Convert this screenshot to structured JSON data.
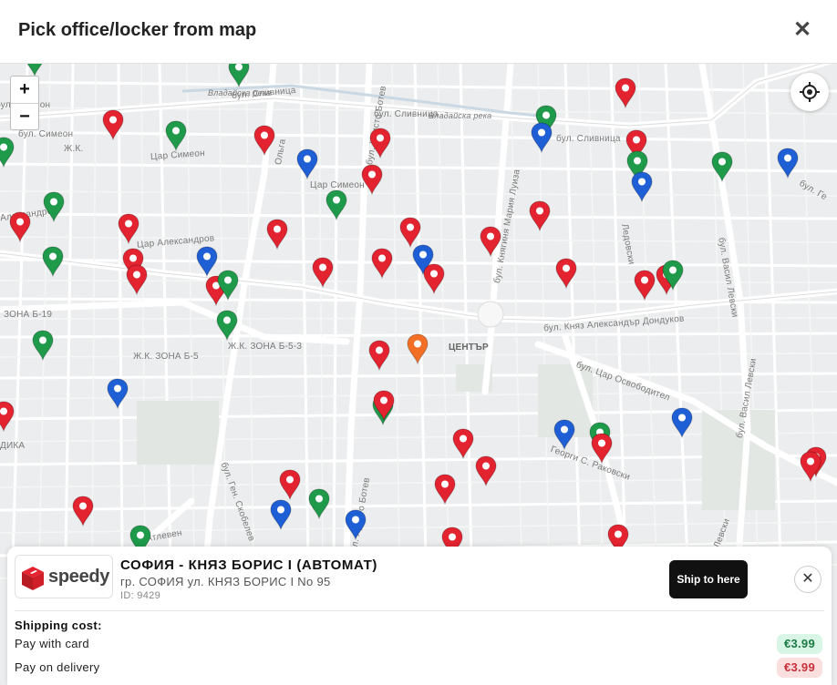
{
  "header": {
    "title": "Pick office/locker from map",
    "close_icon": "close-icon"
  },
  "map": {
    "zoom_in_label": "+",
    "zoom_out_label": "−",
    "locate_icon": "crosshair-icon",
    "streets": [
      "бул. Сливница",
      "бул. Сливница",
      "бул. Сливница",
      "Владайска река",
      "Владайска река",
      "бул. Симеон",
      "бул. Симеон",
      "Цар Симеон",
      "Цар Симеон",
      "Ж.К.",
      "Александров",
      "Цар Александров",
      "ЗОНА Б-19",
      "Ж.К. ЗОНА Б-5",
      "Ж.К. ЗОНА Б-5-3",
      "ЦЕНТЪР",
      "ДИКА",
      "бул. Христо Ботев",
      "бул. Христо Ботев",
      "бул. Княгиня Мария Луиза",
      "бул. Княз Александър Дондуков",
      "бул. Цар Освободител",
      "бул. Васил Левски",
      "бул. Васил Левски",
      "Васил Левски",
      "Георги С. Раковски",
      "бул. Ген. Скобелев",
      "Ольга",
      "Ледовски",
      "Атлевен",
      "бул. Ге"
    ],
    "pin_colors": {
      "red": "#e3232f",
      "green": "#1e9a4a",
      "blue": "#1f5fd6",
      "orange": "#f36f25"
    }
  },
  "panel": {
    "logo_icon": "speedy-cube-icon",
    "brand": "speedy",
    "office_name": "СОФИЯ - КНЯЗ БОРИС I (АВТОМАТ)",
    "office_address": "гр. СОФИЯ ул. КНЯЗ БОРИС I No 95",
    "office_id": "ID: 9429",
    "ship_button": "Ship to here",
    "close_label": "✕",
    "shipping_title": "Shipping cost:",
    "pay_card_label": "Pay with card",
    "pay_card_price": "€3.99",
    "pay_delivery_label": "Pay on delivery",
    "pay_delivery_price": "€3.99"
  }
}
